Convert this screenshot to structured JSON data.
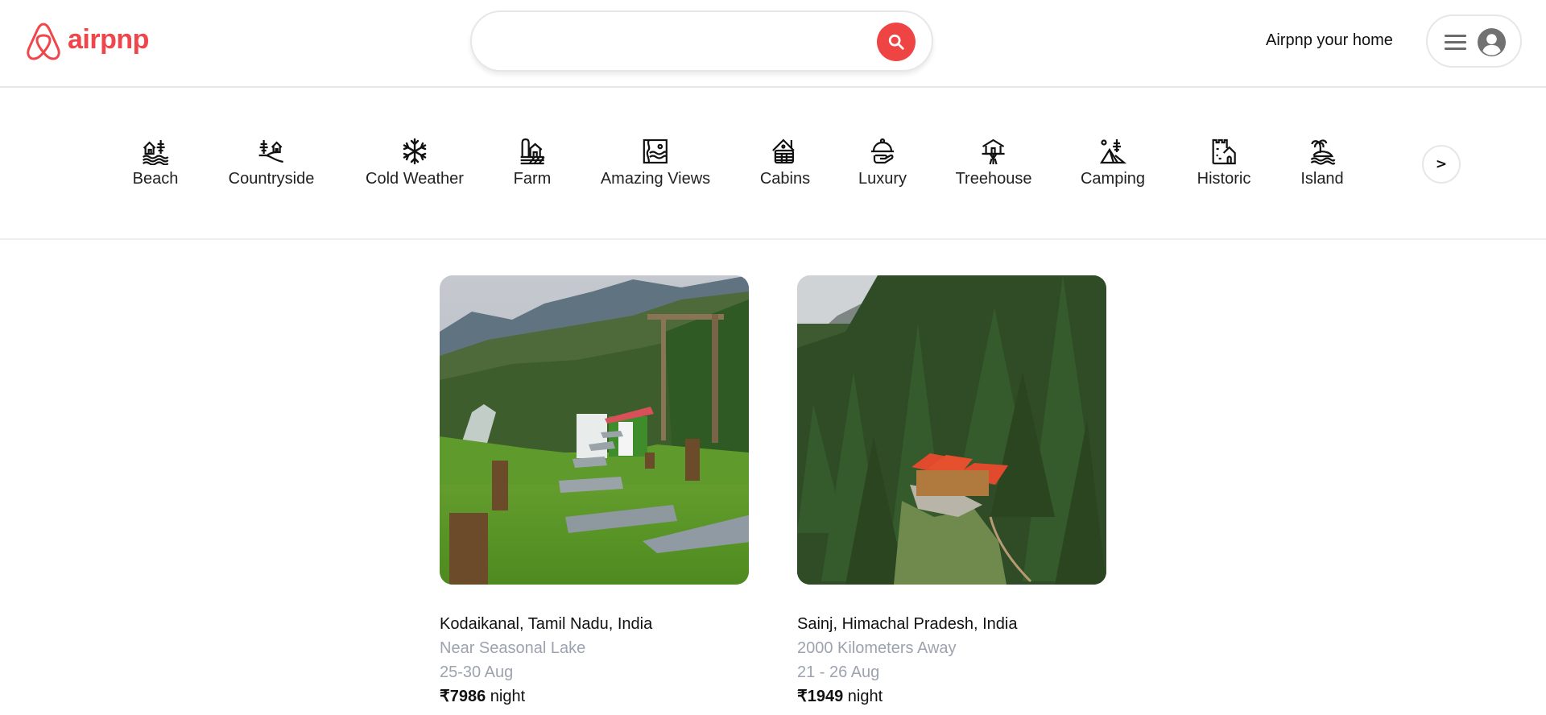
{
  "header": {
    "brand_name": "airpnp",
    "brand_color": "#f0464b",
    "search": {
      "value": "",
      "placeholder": "",
      "button_icon": "search-icon"
    },
    "host_link": "Airpnp your home",
    "user_menu": {
      "menu_icon": "hamburger-icon",
      "avatar_icon": "user-avatar-icon"
    }
  },
  "categories": {
    "items": [
      {
        "label": "Beach",
        "icon": "beach-icon"
      },
      {
        "label": "Countryside",
        "icon": "countryside-icon"
      },
      {
        "label": "Cold Weather",
        "icon": "snowflake-icon"
      },
      {
        "label": "Farm",
        "icon": "farm-icon"
      },
      {
        "label": "Amazing Views",
        "icon": "amazing-views-icon"
      },
      {
        "label": "Cabins",
        "icon": "cabin-icon"
      },
      {
        "label": "Luxury",
        "icon": "luxury-icon"
      },
      {
        "label": "Treehouse",
        "icon": "treehouse-icon"
      },
      {
        "label": "Camping",
        "icon": "camping-icon"
      },
      {
        "label": "Historic",
        "icon": "castle-icon"
      },
      {
        "label": "Island",
        "icon": "island-icon"
      }
    ],
    "next_label": ">"
  },
  "listings": [
    {
      "location": "Kodaikanal, Tamil Nadu, India",
      "description": "Near Seasonal Lake",
      "dates": "25-30 Aug",
      "price": "₹7986",
      "price_unit": "night",
      "photo": "hillside-cottage-with-stone-path"
    },
    {
      "location": "Sainj, Himachal Pradesh, India",
      "description": "2000 Kilometers Away",
      "dates": "21 - 26 Aug",
      "price": "₹1949",
      "price_unit": "night",
      "photo": "red-roof-cabins-in-pine-forest"
    }
  ],
  "colors": {
    "accent": "#ef4444",
    "muted_text": "#9ca3af",
    "border": "#e5e7eb"
  }
}
